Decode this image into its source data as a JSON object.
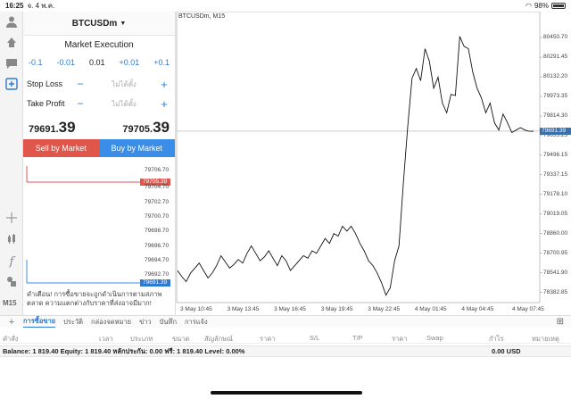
{
  "status": {
    "time": "16:25",
    "date": "จ. 4 พ.ค.",
    "battery": "98%"
  },
  "order": {
    "symbol": "BTCUSDm",
    "execution": "Market Execution",
    "volume_steps": [
      "-0.1",
      "-0.01",
      "0.01",
      "+0.01",
      "+0.1"
    ],
    "stop_loss_label": "Stop Loss",
    "take_profit_label": "Take Profit",
    "not_set": "ไม่ได้ตั้ง",
    "minus": "−",
    "plus": "+",
    "sell_price_prefix": "79691.",
    "sell_price_suffix": "39",
    "buy_price_prefix": "79705.",
    "buy_price_suffix": "39",
    "sell_button": "Sell by Market",
    "buy_button": "Buy by Market",
    "depth_levels": [
      "79706.70",
      "79704.70",
      "79702.70",
      "79700.70",
      "79698.70",
      "79696.70",
      "79694.70",
      "79692.70"
    ],
    "ask_tag": "79705.39",
    "bid_tag": "79691.39",
    "warning": "คำเตือน! การซื้อขายจะถูกดำเนินการตามสภาพตลาด ความแตกต่างกับราคาที่ส่งอาจมีมาก!"
  },
  "chart_data": {
    "type": "line",
    "title": "BTCUSDm, M15",
    "y_ticks": [
      "80450.70",
      "80291.45",
      "80132.20",
      "79973.35",
      "79814.30",
      "79655.25",
      "79496.15",
      "79337.15",
      "79178.10",
      "79019.05",
      "78860.00",
      "78700.95",
      "78541.90",
      "78382.85"
    ],
    "x_ticks": [
      "3 May 10:45",
      "3 May 13:45",
      "3 May 16:45",
      "3 May 19:45",
      "3 May 22:45",
      "4 May 01:45",
      "4 May 04:45",
      "4 May 07:45"
    ],
    "bid_line": "79691.39",
    "ylim": [
      78300,
      80560
    ],
    "values": [
      78560,
      78510,
      78470,
      78540,
      78580,
      78620,
      78560,
      78500,
      78540,
      78600,
      78680,
      78630,
      78580,
      78610,
      78650,
      78620,
      78700,
      78760,
      78700,
      78640,
      78670,
      78720,
      78660,
      78600,
      78680,
      78640,
      78560,
      78600,
      78640,
      78680,
      78660,
      78720,
      78700,
      78760,
      78820,
      78780,
      78860,
      78840,
      78920,
      78880,
      78920,
      78860,
      78780,
      78720,
      78640,
      78600,
      78540,
      78460,
      78360,
      78420,
      78640,
      78760,
      79260,
      79720,
      80120,
      80200,
      80100,
      80360,
      80260,
      80040,
      80130,
      79920,
      79840,
      79990,
      79980,
      80460,
      80380,
      80360,
      80170,
      80040,
      79960,
      79840,
      79920,
      79760,
      79700,
      79830,
      79760,
      79680,
      79700,
      79720,
      79700,
      79690,
      79691
    ]
  },
  "tabs": [
    "การซื้อขาย",
    "ประวัติ",
    "กล่องจดหมาย",
    "ข่าว",
    "บันทึก",
    "การแจ้ง"
  ],
  "grid_columns": [
    "คำสั่ง",
    "เวลา",
    "ประเภท",
    "ขนาด",
    "สัญลักษณ์",
    "ราคา",
    "S/L",
    "T/P",
    "ราคา",
    "Swap",
    "กำไร",
    "หมายเหตุ"
  ],
  "balance": {
    "summary": "Balance: 1 819.40 Equity: 1 819.40 หลักประกัน: 0.00 ฟรี: 1 819.40 Level: 0.00%",
    "pnl": "0.00  USD"
  },
  "colors": {
    "sell": "#e0564b",
    "buy": "#3b8ee8",
    "accent": "#2a7ad6"
  }
}
